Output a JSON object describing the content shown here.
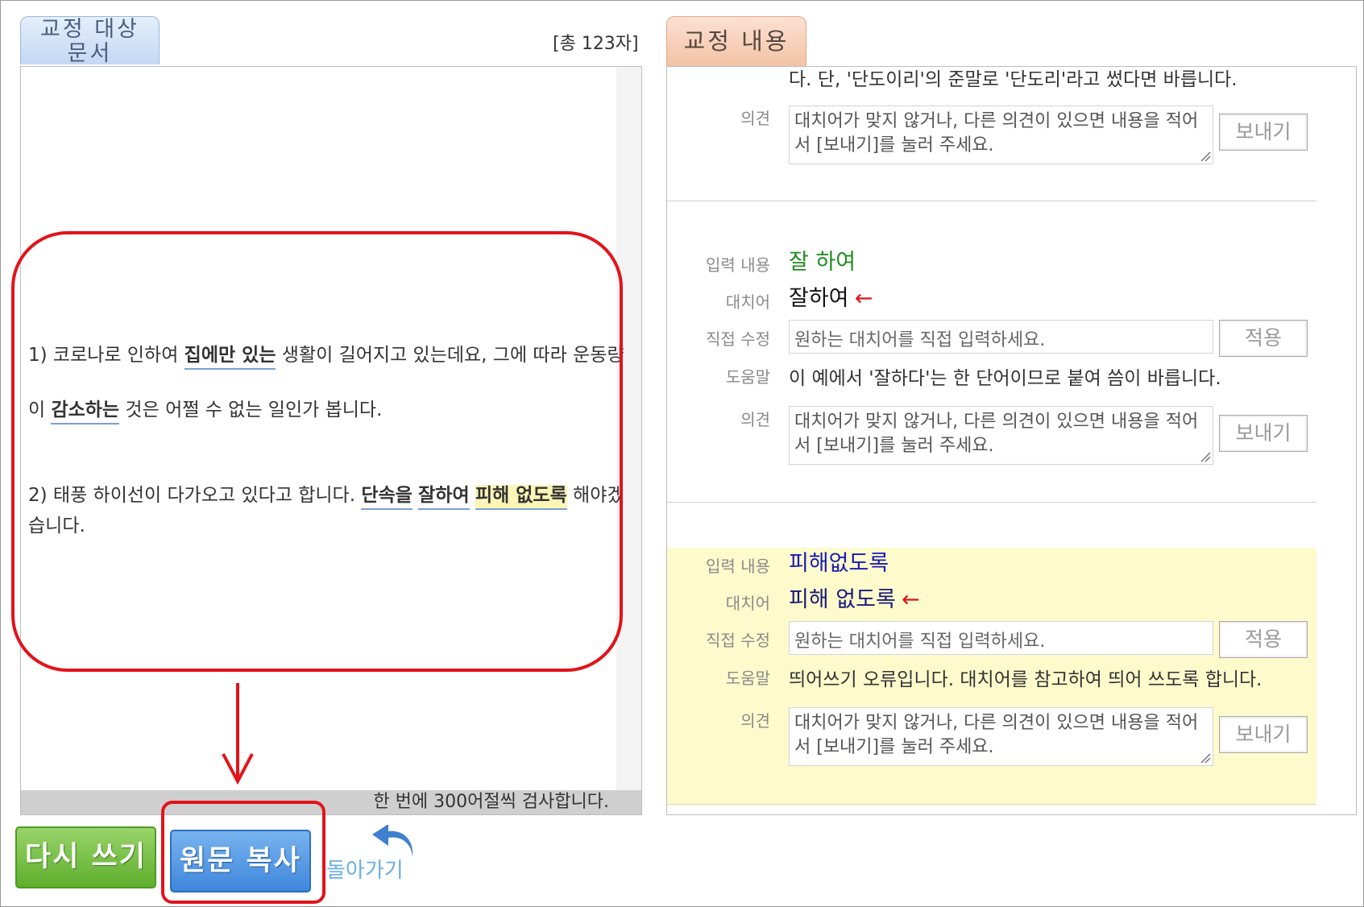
{
  "left_panel": {
    "tab_label": "교정 대상\n문서",
    "char_count": "[총 123자]",
    "paragraphs": {
      "p1_line1": {
        "before": "1) 코로나로 인하여 ",
        "hl1": "집에만 있는",
        "after": " 생활이 길어지고 있는데요, 그에 따라 운동량"
      },
      "p1_line2": {
        "before": "이 ",
        "hl1": "감소하는",
        "after": " 것은 어쩔 수 없는 일인가 봅니다."
      },
      "p2_line1": {
        "before": "2) 태풍 하이선이 다가오고 있다고 합니다. ",
        "hl1": "단속을",
        "hl2": "잘하여",
        "hl3": "피해 없도록",
        "after": " 해야겠"
      },
      "p2_line2": "습니다."
    },
    "footer_note": "한 번에 300어절씩 검사합니다.",
    "buttons": {
      "rewrite": "다시 쓰기",
      "copy_original": "원문 복사",
      "go_back": "돌아가기"
    }
  },
  "right_panel": {
    "tab_label": "교정 내용",
    "truncated_help": "다. 단, '단도이리'의 준말로 '단도리'라고 썼다면 바릅니다.",
    "labels": {
      "input": "입력 내용",
      "replacement": "대치어",
      "direct_edit": "직접 수정",
      "help": "도움말",
      "opinion": "의견"
    },
    "opinion_placeholder": "대치어가 맞지 않거나, 다른 의견이 있으면 내용을 적어서 [보내기]를 눌러 주세요.",
    "direct_edit_placeholder": "원하는 대치어를 직접 입력하세요.",
    "send_button": "보내기",
    "apply_button": "적용",
    "arrow": "←",
    "items": [
      {
        "input": "잘 하여",
        "replacement": "잘하여",
        "help": "이 예에서 '잘하다'는 한 단어이므로 붙여 씀이 바릅니다."
      },
      {
        "input": "피해없도록",
        "replacement": "피해 없도록",
        "help": "띄어쓰기 오류입니다. 대치어를 참고하여 띄어 쓰도록 합니다."
      }
    ]
  },
  "colors": {
    "highlight_border": "#e2131a",
    "input_green": "#1f8d1f",
    "input_blue": "#1a1ab8",
    "yellow_bg": "#fdfbcc"
  }
}
